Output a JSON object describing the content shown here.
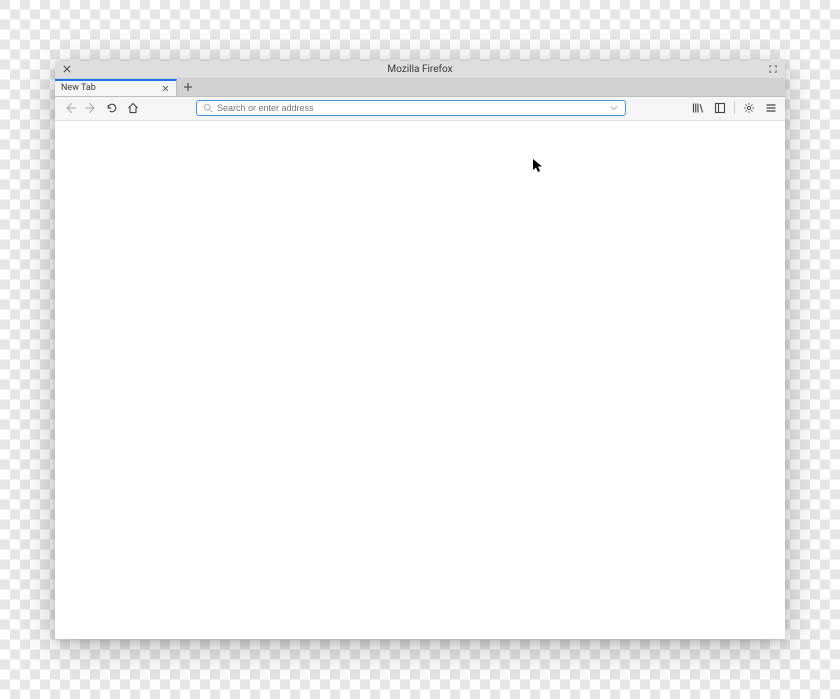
{
  "window": {
    "title": "Mozilla Firefox"
  },
  "tab": {
    "label": "New Tab"
  },
  "urlbar": {
    "placeholder": "Search or enter address",
    "value": ""
  }
}
